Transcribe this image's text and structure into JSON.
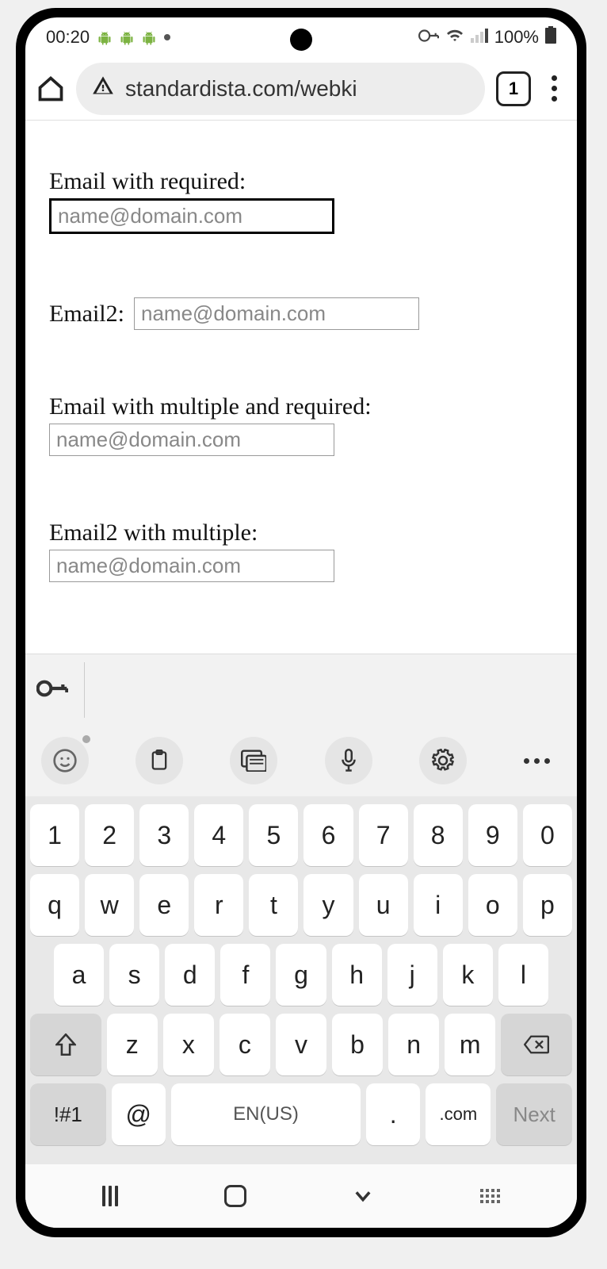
{
  "status": {
    "time": "00:20",
    "battery": "100%"
  },
  "browser": {
    "url": "standardista.com/webki",
    "tab_count": "1"
  },
  "form": {
    "f1_label": "Email with required:",
    "f1_placeholder": "name@domain.com",
    "f2_label": "Email2:",
    "f2_placeholder": "name@domain.com",
    "f3_label": "Email with multiple and required:",
    "f3_placeholder": "name@domain.com",
    "f4_label": "Email2 with multiple:",
    "f4_placeholder": "name@domain.com"
  },
  "keyboard": {
    "row_num": [
      "1",
      "2",
      "3",
      "4",
      "5",
      "6",
      "7",
      "8",
      "9",
      "0"
    ],
    "row1": [
      "q",
      "w",
      "e",
      "r",
      "t",
      "y",
      "u",
      "i",
      "o",
      "p"
    ],
    "row2": [
      "a",
      "s",
      "d",
      "f",
      "g",
      "h",
      "j",
      "k",
      "l"
    ],
    "row3": [
      "z",
      "x",
      "c",
      "v",
      "b",
      "n",
      "m"
    ],
    "sym_key": "!#1",
    "at_key": "@",
    "space_label": "EN(US)",
    "period_key": ".",
    "com_key": ".com",
    "next_key": "Next"
  }
}
